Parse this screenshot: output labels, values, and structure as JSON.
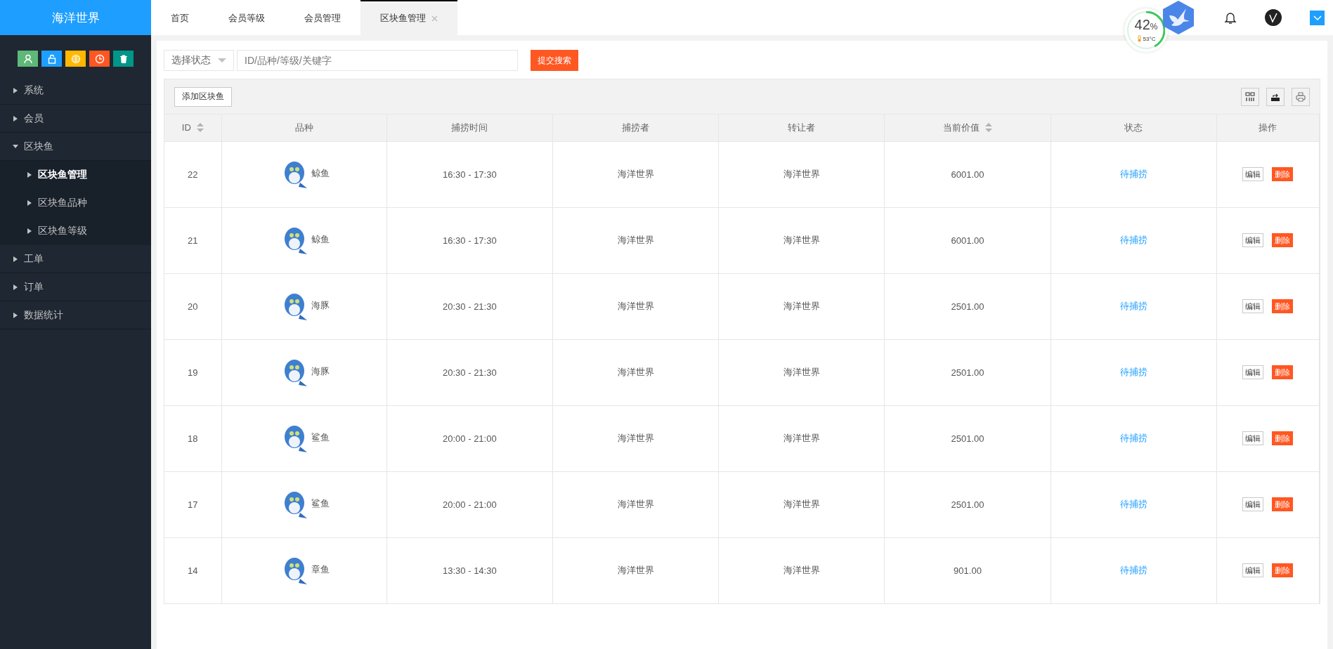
{
  "logo": {
    "title": "海洋世界"
  },
  "tabs": [
    {
      "label": "首页",
      "selected": false,
      "closable": false
    },
    {
      "label": "会员等级",
      "selected": false,
      "closable": false
    },
    {
      "label": "会员管理",
      "selected": false,
      "closable": false
    },
    {
      "label": "区块鱼管理",
      "selected": true,
      "closable": true
    }
  ],
  "monitor": {
    "percent": "42",
    "unit": "%",
    "temperature": "53°C",
    "level": 0.42
  },
  "quick_buttons": [
    {
      "color": "#5fb878",
      "kind": "user"
    },
    {
      "color": "#1e9fff",
      "kind": "lock"
    },
    {
      "color": "#ffb800",
      "kind": "globe"
    },
    {
      "color": "#ff5722",
      "kind": "clock"
    },
    {
      "color": "#009688",
      "kind": "trash"
    }
  ],
  "sidebar": {
    "items": [
      {
        "label": "系统",
        "expanded": false,
        "selected": false
      },
      {
        "label": "会员",
        "expanded": false,
        "selected": false
      },
      {
        "label": "区块鱼",
        "expanded": true,
        "selected": false,
        "children": [
          {
            "label": "区块鱼管理",
            "selected": true
          },
          {
            "label": "区块鱼品种",
            "selected": false
          },
          {
            "label": "区块鱼等级",
            "selected": false
          }
        ]
      },
      {
        "label": "工单",
        "expanded": false,
        "selected": false
      },
      {
        "label": "订单",
        "expanded": false,
        "selected": false
      },
      {
        "label": "数据统计",
        "expanded": false,
        "selected": false
      }
    ]
  },
  "search": {
    "status_select": "选择状态",
    "placeholder": "ID/品种/等级/关键字",
    "submit": "提交搜索"
  },
  "toolbar": {
    "add_button": "添加区块鱼"
  },
  "table": {
    "columns": [
      {
        "label": "ID",
        "sortable": true
      },
      {
        "label": "品种",
        "sortable": false
      },
      {
        "label": "捕捞时间",
        "sortable": false
      },
      {
        "label": "捕捞者",
        "sortable": false
      },
      {
        "label": "转让者",
        "sortable": false
      },
      {
        "label": "当前价值",
        "sortable": true
      },
      {
        "label": "状态",
        "sortable": false
      },
      {
        "label": "操作",
        "sortable": false
      }
    ],
    "rows": [
      {
        "id": "22",
        "species": "鲸鱼",
        "time": "16:30 - 17:30",
        "catcher": "海洋世界",
        "transferrer": "海洋世界",
        "value": "6001.00",
        "status": "待捕捞",
        "actions": [
          "编辑",
          "删除"
        ]
      },
      {
        "id": "21",
        "species": "鲸鱼",
        "time": "16:30 - 17:30",
        "catcher": "海洋世界",
        "transferrer": "海洋世界",
        "value": "6001.00",
        "status": "待捕捞",
        "actions": [
          "编辑",
          "删除"
        ]
      },
      {
        "id": "20",
        "species": "海豚",
        "time": "20:30 - 21:30",
        "catcher": "海洋世界",
        "transferrer": "海洋世界",
        "value": "2501.00",
        "status": "待捕捞",
        "actions": [
          "编辑",
          "删除"
        ]
      },
      {
        "id": "19",
        "species": "海豚",
        "time": "20:30 - 21:30",
        "catcher": "海洋世界",
        "transferrer": "海洋世界",
        "value": "2501.00",
        "status": "待捕捞",
        "actions": [
          "编辑",
          "删除"
        ]
      },
      {
        "id": "18",
        "species": "鲨鱼",
        "time": "20:00 - 21:00",
        "catcher": "海洋世界",
        "transferrer": "海洋世界",
        "value": "2501.00",
        "status": "待捕捞",
        "actions": [
          "编辑",
          "删除"
        ]
      },
      {
        "id": "17",
        "species": "鲨鱼",
        "time": "20:00 - 21:00",
        "catcher": "海洋世界",
        "transferrer": "海洋世界",
        "value": "2501.00",
        "status": "待捕捞",
        "actions": [
          "编辑",
          "删除"
        ]
      },
      {
        "id": "14",
        "species": "章鱼",
        "time": "13:30 - 14:30",
        "catcher": "海洋世界",
        "transferrer": "海洋世界",
        "value": "901.00",
        "status": "待捕捞",
        "actions": [
          "编辑",
          "删除"
        ]
      }
    ]
  }
}
